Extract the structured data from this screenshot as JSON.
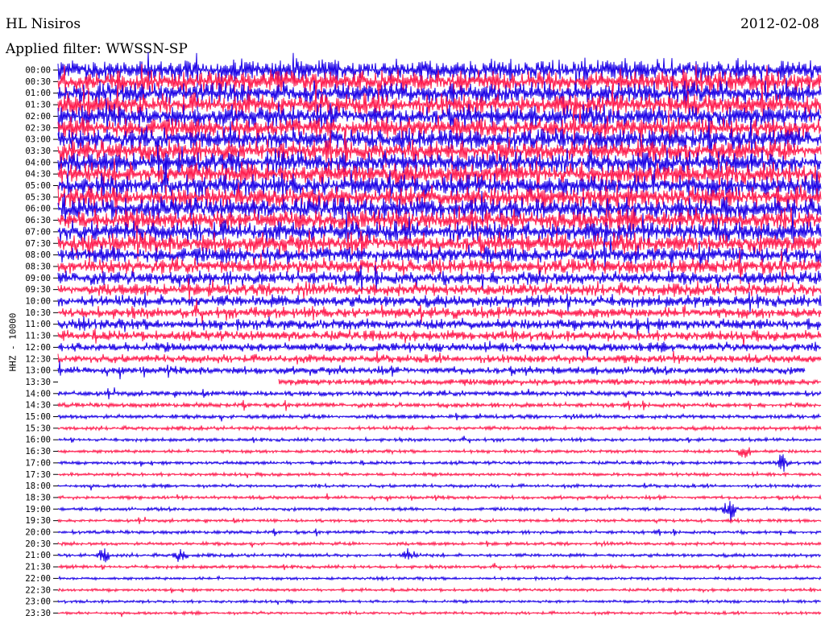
{
  "header": {
    "station": "HL Nisiros",
    "date": "2012-02-08",
    "filter_label": "Applied filter: WWSSN-SP"
  },
  "chart_data": {
    "type": "line",
    "title": "HL Nisiros",
    "ylabel": "HHZ - 10000",
    "xlabel": "",
    "filter": "WWSSN-SP",
    "colors": [
      "#1a00e6",
      "#ff1a4d"
    ],
    "background": "#ffffff",
    "grid": false,
    "line_interval_minutes": 30,
    "traces_total": 48,
    "row_labels": [
      "00:00",
      "00:30",
      "01:00",
      "01:30",
      "02:00",
      "02:30",
      "03:00",
      "03:30",
      "04:00",
      "04:30",
      "05:00",
      "05:30",
      "06:00",
      "06:30",
      "07:00",
      "07:30",
      "08:00",
      "08:30",
      "09:00",
      "09:30",
      "10:00",
      "10:30",
      "11:00",
      "11:30",
      "12:00",
      "12:30",
      "13:00",
      "13:30",
      "14:00",
      "14:30",
      "15:00",
      "15:30",
      "16:00",
      "16:30",
      "17:00",
      "17:30",
      "18:00",
      "18:30",
      "19:00",
      "19:30",
      "20:00",
      "20:30",
      "21:00",
      "21:30",
      "22:00",
      "22:30",
      "23:00",
      "23:30"
    ],
    "relative_amplitude": [
      5.0,
      5.0,
      5.0,
      5.0,
      5.0,
      5.0,
      5.0,
      5.0,
      5.0,
      5.0,
      5.0,
      5.0,
      5.0,
      5.0,
      4.8,
      4.6,
      4.0,
      3.6,
      3.2,
      3.0,
      2.8,
      2.6,
      2.6,
      2.4,
      2.2,
      2.0,
      1.8,
      1.6,
      1.3,
      1.1,
      1.0,
      0.9,
      0.8,
      0.8,
      0.8,
      0.8,
      0.8,
      0.8,
      0.8,
      0.8,
      0.8,
      0.8,
      0.8,
      0.8,
      0.7,
      0.7,
      0.7,
      0.7
    ],
    "events": [
      {
        "row": "16:30",
        "time_fraction": 0.9,
        "relative_amplitude": 3
      },
      {
        "row": "17:00",
        "time_fraction": 0.95,
        "relative_amplitude": 3
      },
      {
        "row": "19:00",
        "time_fraction": 0.88,
        "relative_amplitude": 5
      },
      {
        "row": "21:00",
        "time_fraction": 0.06,
        "relative_amplitude": 2.5
      },
      {
        "row": "21:00",
        "time_fraction": 0.16,
        "relative_amplitude": 2.5
      },
      {
        "row": "21:00",
        "time_fraction": 0.46,
        "relative_amplitude": 2.5
      }
    ]
  }
}
